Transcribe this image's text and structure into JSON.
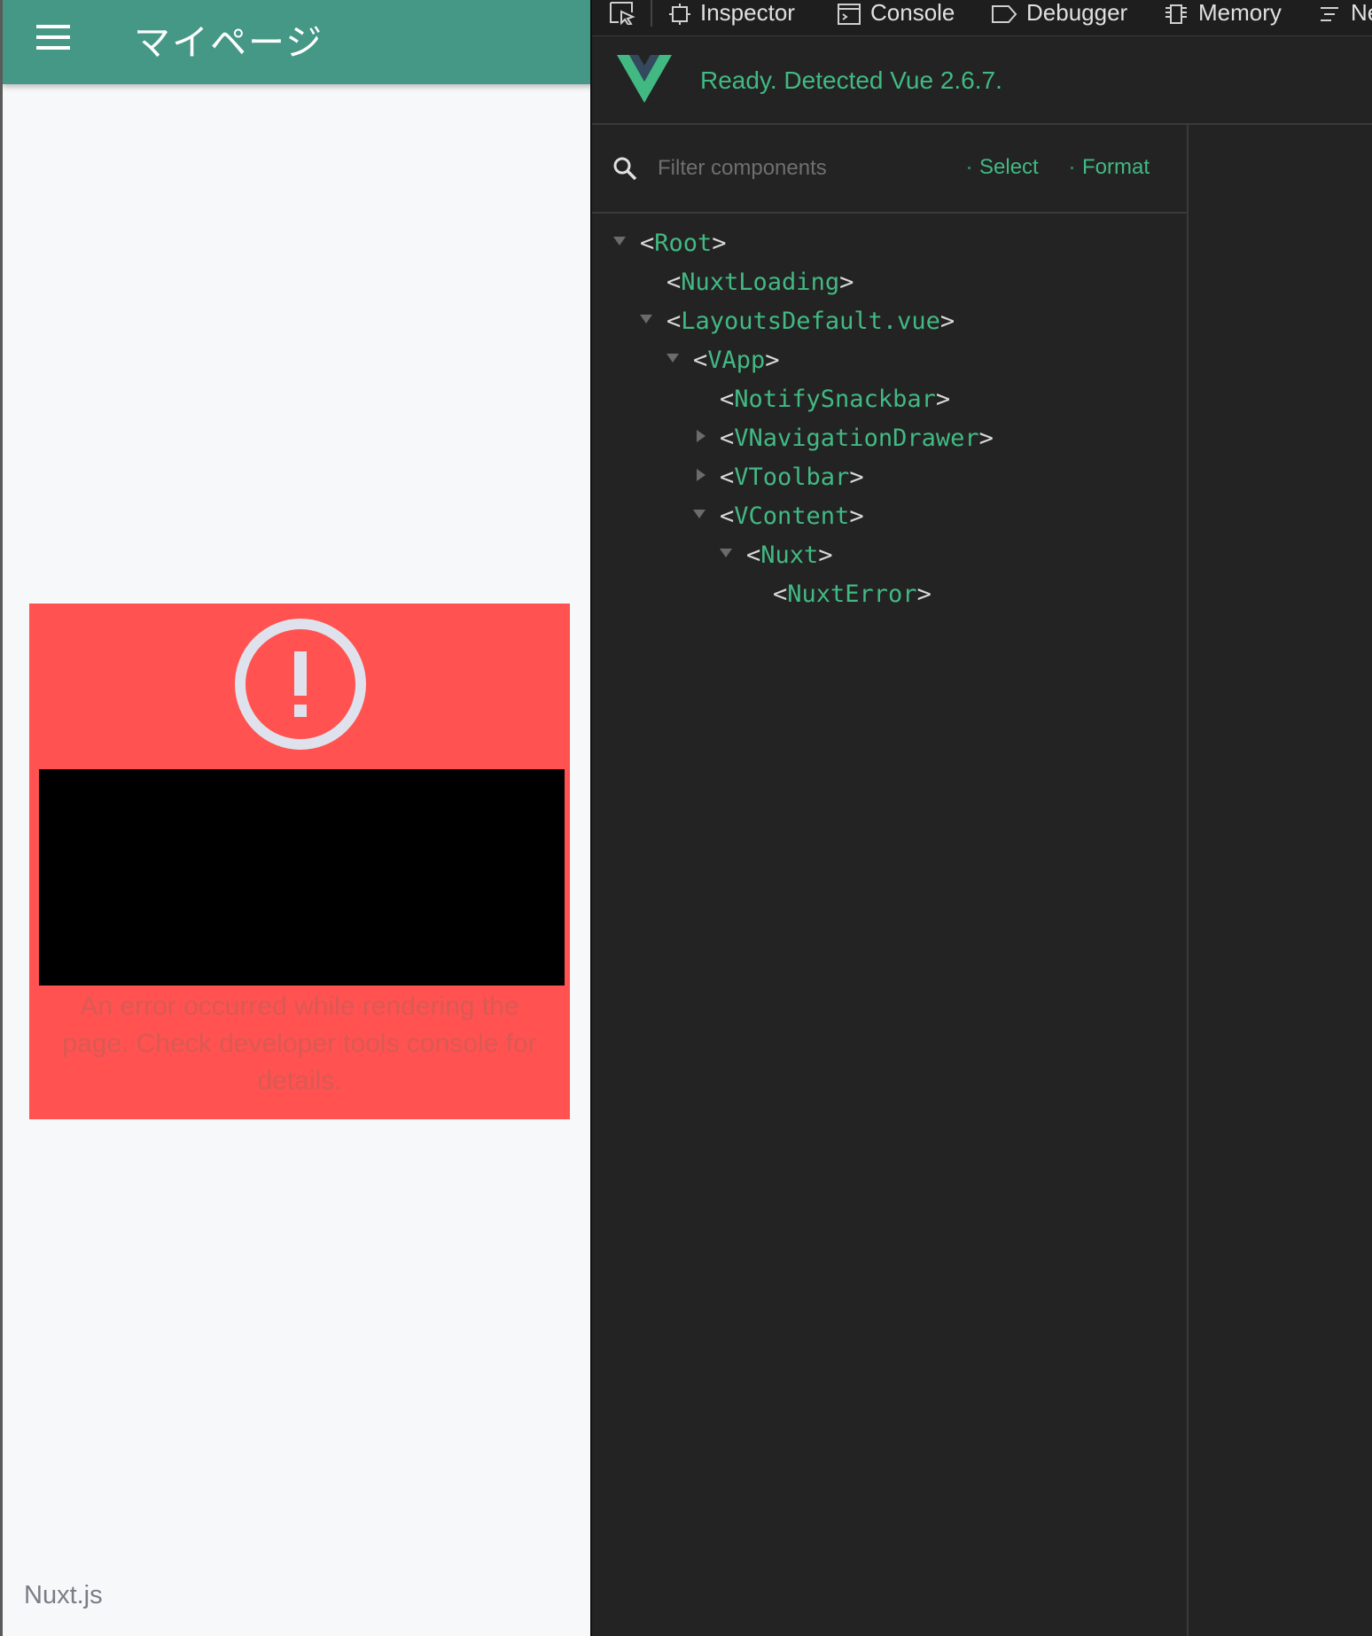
{
  "app": {
    "title": "マイページ",
    "footer": "Nuxt.js"
  },
  "error": {
    "description": "An error occurred while rendering the page. Check developer tools console for details."
  },
  "devtools": {
    "tabs": [
      {
        "label": "Inspector",
        "icon": "inspector-icon"
      },
      {
        "label": "Console",
        "icon": "console-icon"
      },
      {
        "label": "Debugger",
        "icon": "debugger-icon"
      },
      {
        "label": "Memory",
        "icon": "memory-icon"
      },
      {
        "label": "Ne",
        "icon": "network-icon"
      }
    ],
    "vue_status": "Ready. Detected Vue 2.6.7.",
    "filter_placeholder": "Filter components",
    "select_label": "Select",
    "format_label": "Format",
    "tree": [
      {
        "name": "Root",
        "depth": 0,
        "expanded": "down"
      },
      {
        "name": "NuxtLoading",
        "depth": 1,
        "expanded": "none"
      },
      {
        "name": "LayoutsDefault.vue",
        "depth": 1,
        "expanded": "down"
      },
      {
        "name": "VApp",
        "depth": 2,
        "expanded": "down"
      },
      {
        "name": "NotifySnackbar",
        "depth": 3,
        "expanded": "none"
      },
      {
        "name": "VNavigationDrawer",
        "depth": 3,
        "expanded": "right"
      },
      {
        "name": "VToolbar",
        "depth": 3,
        "expanded": "right"
      },
      {
        "name": "VContent",
        "depth": 3,
        "expanded": "down"
      },
      {
        "name": "Nuxt",
        "depth": 4,
        "expanded": "down"
      },
      {
        "name": "NuxtError",
        "depth": 5,
        "expanded": "none"
      }
    ]
  },
  "colors": {
    "appbar": "#459886",
    "error_card": "#ff5251",
    "vue_green": "#42b983",
    "devtools_bg": "#232323"
  }
}
